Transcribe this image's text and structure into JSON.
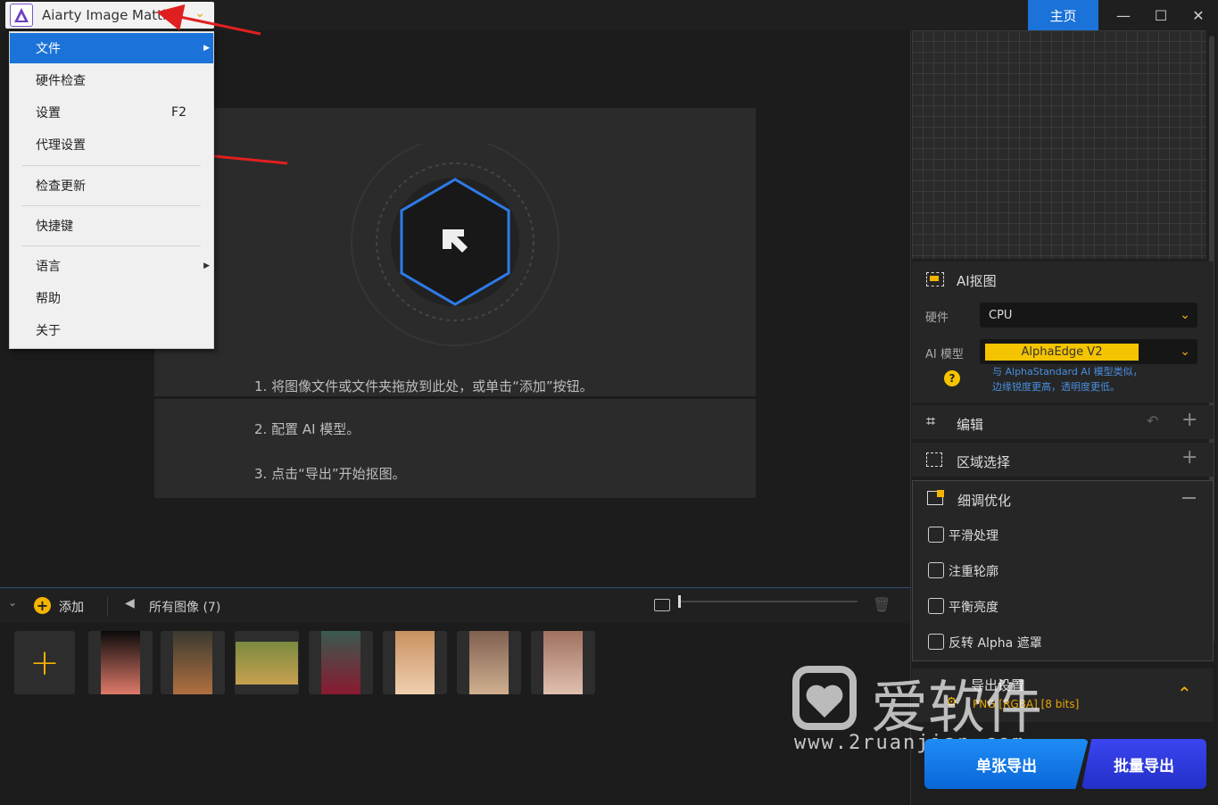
{
  "app": {
    "title": "Aiarty Image Matting",
    "home_tab": "主页"
  },
  "window_controls": {
    "minimize": "—",
    "maximize": "☐",
    "close": "✕"
  },
  "menu": {
    "items": [
      {
        "label": "文件",
        "shortcut": "",
        "submenu": true,
        "selected": true
      },
      {
        "label": "硬件检查",
        "shortcut": ""
      },
      {
        "label": "设置",
        "shortcut": "F2"
      },
      {
        "label": "代理设置",
        "shortcut": ""
      },
      {
        "label": "检查更新",
        "shortcut": ""
      },
      {
        "label": "快捷键",
        "shortcut": ""
      },
      {
        "label": "语言",
        "shortcut": "",
        "submenu": true
      },
      {
        "label": "帮助",
        "shortcut": ""
      },
      {
        "label": "关于",
        "shortcut": ""
      }
    ]
  },
  "main": {
    "step1": "1. 将图像文件或文件夹拖放到此处，或单击“添加”按钮。",
    "step2": "2. 配置 AI 模型。",
    "step3": "3. 点击“导出”开始抠图。"
  },
  "bottombar": {
    "add_label": "添加",
    "all_images": "所有图像 (7)"
  },
  "thumbnails": [
    {
      "name": "jellyfish",
      "colors": [
        "#0a0a0a",
        "#e07a6a"
      ]
    },
    {
      "name": "bird",
      "colors": [
        "#3a3a30",
        "#b07040"
      ]
    },
    {
      "name": "bicycle",
      "colors": [
        "#7a8a40",
        "#c8a050"
      ]
    },
    {
      "name": "forest-woman",
      "colors": [
        "#3a5a50",
        "#8a1a30"
      ]
    },
    {
      "name": "flower-woman",
      "colors": [
        "#c89060",
        "#f0d0b0"
      ]
    },
    {
      "name": "woman-dress",
      "colors": [
        "#806050",
        "#d0b090"
      ]
    },
    {
      "name": "woman-flowers",
      "colors": [
        "#a07060",
        "#e0c0b0"
      ]
    }
  ],
  "right_panel": {
    "ai_matting": {
      "title": "AI抠图",
      "hardware_label": "硬件",
      "hardware_value": "CPU",
      "model_label": "AI 模型",
      "model_value": "AlphaEdge  V2",
      "model_desc_1": "与 AlphaStandard AI 模型类似，",
      "model_desc_2": "边缘锐度更高，透明度更低。"
    },
    "edit": {
      "title": "编辑"
    },
    "region": {
      "title": "区域选择"
    },
    "refine": {
      "title": "细调优化",
      "options": [
        "平滑处理",
        "注重轮廓",
        "平衡亮度",
        "反转 Alpha 遮罩"
      ]
    },
    "export_settings": {
      "title": "导出设置",
      "format": "PNG [RGBA] [8 bits]"
    },
    "btn_single": "单张导出",
    "btn_batch": "批量导出"
  },
  "watermark": {
    "text": "爱软件",
    "url": "www.2ruanjian.com"
  },
  "colors": {
    "accent": "#1b72d8",
    "yellow": "#f5c400",
    "arrow": "#e02020"
  }
}
